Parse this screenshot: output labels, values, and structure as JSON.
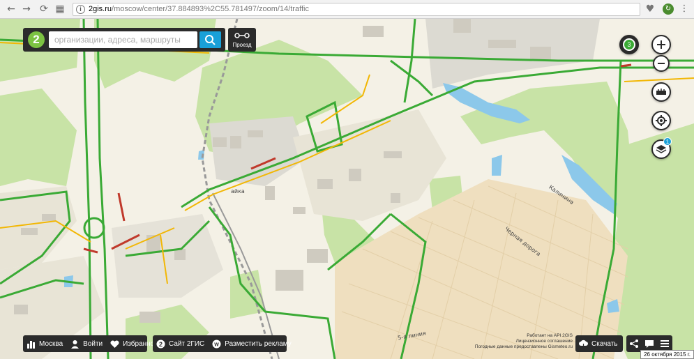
{
  "browser": {
    "url_host": "2gis.ru",
    "url_path": "/moscow/center/37.884893%2C55.781497/zoom/14/traffic",
    "nav_icons": [
      "back-icon",
      "forward-icon",
      "reload-icon",
      "apps-icon"
    ],
    "extension_icons": [
      "heart-icon",
      "stats-icon",
      "menu-icon"
    ]
  },
  "search": {
    "logo_text": "2",
    "placeholder": "организации, адреса, маршруты"
  },
  "route_button": {
    "label": "Проезд"
  },
  "controls": {
    "traffic_score": "3",
    "layers_badge": "1",
    "zoom_in": "+",
    "zoom_out": "−"
  },
  "bottom_left": {
    "city": "Москва",
    "login": "Войти",
    "favorites": "Избранное"
  },
  "bottom_mid": {
    "site": "Сайт 2ГИС",
    "advertise": "Разместить рекламу"
  },
  "download": {
    "label": "Скачать"
  },
  "attribution": {
    "line1": "Работает на API 2GIS",
    "line2": "Лицензионное соглашение",
    "line3": "Погодные данные предоставлены Gismeteo.ru"
  },
  "date_text": "26 октября 2015 г.",
  "map_labels": {
    "station": "айка",
    "street1": "Калинина",
    "street2": "Черная дорога",
    "street3": "5-я линия"
  },
  "colors": {
    "traffic_green": "#3aaa35",
    "traffic_yellow": "#f2b705",
    "traffic_red": "#c0392b",
    "park": "#c8e3a6",
    "water": "#8cc8ea",
    "accent": "#19a0d8"
  }
}
